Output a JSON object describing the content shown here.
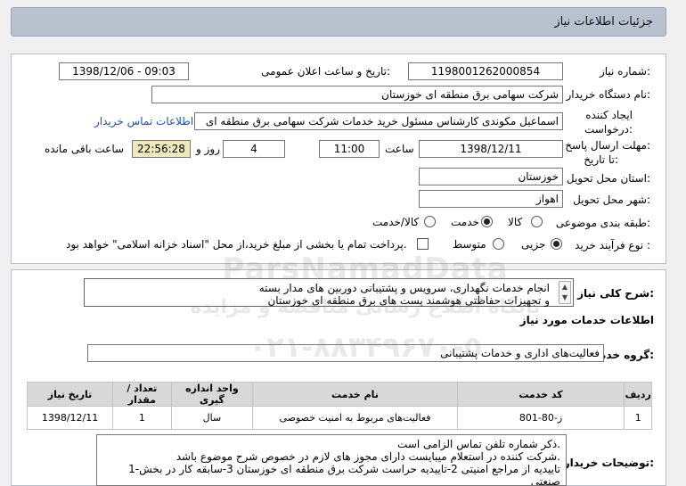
{
  "header": {
    "title": "جزئیات اطلاعات نیاز"
  },
  "fields": {
    "need_number_label": "شماره نیاز:",
    "need_number": "1198001262000854",
    "announce_label": "تاریخ و ساعت اعلان عمومی:",
    "announce_value": "1398/12/06 - 09:03",
    "buyer_org_label": "نام دستگاه خریدار:",
    "buyer_org": "شرکت سهامی برق منطقه ای خوزستان",
    "creator_label_1": "ایجاد کننده",
    "creator_label_2": "درخواست:",
    "creator": "اسماعیل مکوندی کارشناس مسئول خرید خدمات شرکت سهامی برق منطقه ای",
    "contact_link": "اطلاعات تماس خریدار",
    "deadline_label_1": "مهلت ارسال پاسخ:",
    "deadline_label_2": "تا تاریخ:",
    "deadline_date": "1398/12/11",
    "time_label": "ساعت",
    "deadline_time": "11:00",
    "days_value": "4",
    "days_label": "روز و",
    "remaining_time": "22:56:28",
    "remaining_label": "ساعت باقی مانده",
    "province_label": "استان محل تحویل:",
    "province": "خوزستان",
    "city_label": "شهر محل تحویل:",
    "city": "اهواز",
    "category_label": "طبقه بندی موضوعی:",
    "category_options": [
      "کالا",
      "خدمت",
      "کالا/خدمت"
    ],
    "purchase_type_label": "نوع فرآیند خرید :",
    "purchase_options": [
      "جزیی",
      "متوسط"
    ],
    "treasury_text": "پرداخت تمام یا بخشی از مبلغ خرید،از محل \"اسناد خزانه اسلامی\" خواهد بود."
  },
  "summary": {
    "label": "شرح کلی نیاز:",
    "lines": [
      "انجام خدمات نگهداری، سرویس و پشتیبانی دوربین های مدار بسته",
      "و تجهیزات حفاظتی هوشمند پست های برق منطقه ای خوزستان"
    ]
  },
  "services_title": "اطلاعات خدمات مورد نیاز",
  "service_group": {
    "label": "گروه خدمت:",
    "value": "فعالیت‌های اداری و خدمات پشتیبانی"
  },
  "table": {
    "headers": [
      "ردیف",
      "کد خدمت",
      "نام خدمت",
      "واحد اندازه گیری",
      "تعداد / مقدار",
      "تاریخ نیاز"
    ],
    "rows": [
      [
        "1",
        "ز-80-801",
        "فعالیت‌های مربوط به امنیت خصوصی",
        "سال",
        "1",
        "1398/12/11"
      ]
    ]
  },
  "buyer_notes": {
    "label": "توضیحات خریدار:",
    "lines": [
      "ذکر شماره تلفن تماس الزامی است.",
      "شرکت کننده در استعلام میبایست دارای مجوز های لازم در خصوص شرح موضوع باشد.",
      "1-تاییدیه از مراجع امنیتی    2-تاییدیه حراست شرکت برق منطقه ای خوزستان     3-سابقه کار در بخش",
      "صنعتی"
    ]
  },
  "watermark": {
    "line1": "ParsNamadData",
    "line2": "پایگاه اطلاع رسانی مناقصه و مزایده",
    "line3": "۰۲۱-۸۸۳۴۹۶۷۰-۵"
  }
}
